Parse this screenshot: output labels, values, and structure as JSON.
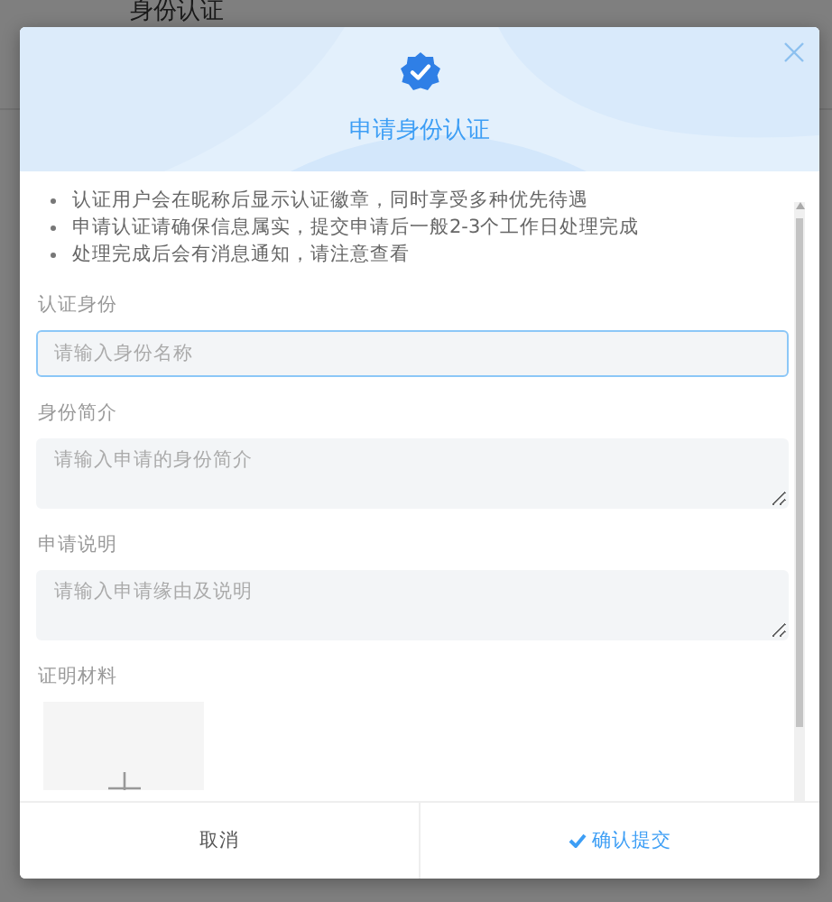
{
  "background_page": {
    "title": "身份认证"
  },
  "dialog": {
    "title": "申请身份认证",
    "notices": [
      "认证用户会在昵称后显示认证徽章，同时享受多种优先待遇",
      "申请认证请确保信息属实，提交申请后一般2-3个工作日处理完成",
      "处理完成后会有消息通知，请注意查看"
    ],
    "fields": [
      {
        "kind": "input",
        "label": "认证身份",
        "placeholder": "请输入身份名称",
        "focused": true
      },
      {
        "kind": "textarea",
        "label": "身份简介",
        "placeholder": "请输入申请的身份简介",
        "focused": false
      },
      {
        "kind": "textarea",
        "label": "申请说明",
        "placeholder": "请输入申请缘由及说明",
        "focused": false
      },
      {
        "kind": "upload",
        "label": "证明材料"
      }
    ],
    "buttons": [
      {
        "label": "取消",
        "kind": "cancel"
      },
      {
        "label": "确认提交",
        "kind": "confirm"
      }
    ]
  }
}
